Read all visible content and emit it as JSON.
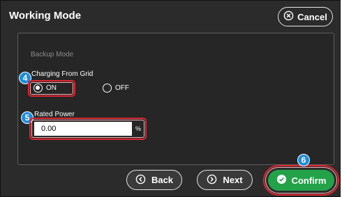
{
  "header": {
    "title": "Working Mode",
    "cancel_label": "Cancel"
  },
  "panel": {
    "section_label": "Backup Mode",
    "charging": {
      "label": "Charging From Grid",
      "options": [
        "ON",
        "OFF"
      ],
      "selected": "ON"
    },
    "rated_power": {
      "label": "Rated Power",
      "value": "0.00",
      "unit": "%"
    }
  },
  "steps": [
    "4",
    "5",
    "6"
  ],
  "footer": {
    "back_label": "Back",
    "next_label": "Next",
    "confirm_label": "Confirm"
  },
  "colors": {
    "background": "#2b2b2b",
    "highlight": "#e0242f",
    "badge": "#1d8ddb",
    "confirm": "#23a24a"
  }
}
